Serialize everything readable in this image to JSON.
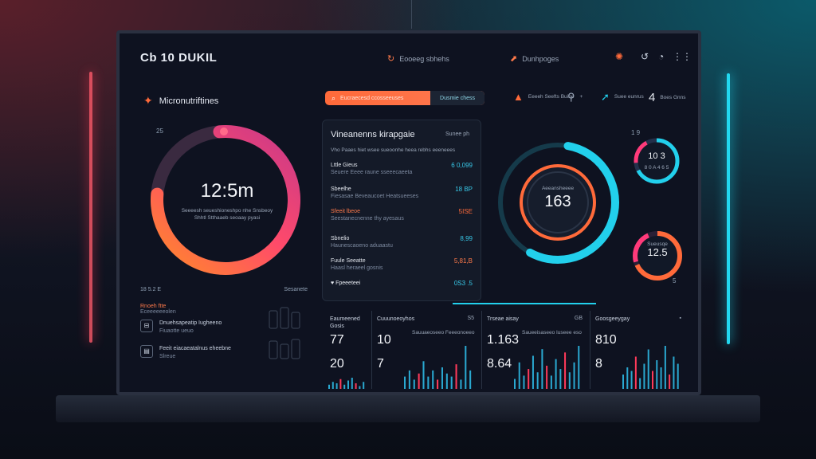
{
  "topbar": {
    "brand": "Cb 10 DUKIL",
    "item1": "Eooeeg sbhehs",
    "item2": "Dunhpoges"
  },
  "sidebar_title": "Micronutriftines",
  "search": {
    "label": "Eucraecesd ccosseeuses",
    "tab2": "Dusmie chess"
  },
  "header_stats": [
    {
      "icon": "warning-icon",
      "text": "Eeeeh Seefts Buine"
    },
    {
      "icon": "search-icon",
      "text": "+"
    },
    {
      "icon": "nav-icon",
      "text": "Suee eunrus"
    },
    {
      "icon": "four",
      "number": "4",
      "text": "Boes Gnns"
    }
  ],
  "main_ring": {
    "value": "12:5m",
    "sub": "Seeeesh seueshioneshpo nhe Snsbeoy Shhtl Stthaaeb seoaay pyasi",
    "corner": "25"
  },
  "left_list": {
    "head_left": "18 5.2 E",
    "head_right": "Sesanete",
    "top": "Rnoeh ftte",
    "top_sub": "Eceeeeeeolen",
    "items": [
      {
        "title": "Dnuehsapeatip Iugheeno",
        "sub": "Fiuaotte ueuo"
      },
      {
        "title": "Feeit eiacaeatalnus eheebne",
        "sub": "Slreue"
      }
    ]
  },
  "panel": {
    "title": "Vineanenns kirapgaie",
    "badge": "Sunee ph",
    "sub": "Vho Paaes hiet wsee sueoonhe heea rebhs eeeneees",
    "rows": [
      {
        "name": "Lttle Gieus",
        "sub": "Seuere Eeee raune sseeecaeeta",
        "value": "6 0,099",
        "style": "normal"
      },
      {
        "name": "Sbeelhe",
        "sub": "Fiesasae Beveaucoet Heatsueeses",
        "value": "18 BP",
        "style": "normal"
      },
      {
        "name": "Sfeeit lbeoe",
        "sub": "Seestanecnenne thy ayesaus",
        "value": "5ISE",
        "style": "hot"
      },
      {
        "name": "Sbnelio",
        "sub": "Haunescaoeno aduaastu",
        "value": "8,99",
        "style": "normal"
      },
      {
        "name": "Fuule Seeatte",
        "sub": "Haasl heraeel gosnis",
        "value": "5,81,B",
        "style": "hot"
      },
      {
        "name": "♥ Fpeeeteei",
        "sub": "",
        "value": "0S3 .5",
        "style": "normal"
      }
    ]
  },
  "gauge": {
    "value": "163",
    "label": "Aeeansheeee",
    "corner": "1 9"
  },
  "small_ring1": {
    "value": "10 3",
    "sub": "8 0 A 4 6 5"
  },
  "small_ring2": {
    "value": "12.5",
    "sub": "Sueusqe",
    "corner": "5"
  },
  "cards": [
    {
      "title": "Eaumeened Gosis",
      "icon": "",
      "v1": "77",
      "v2": "20",
      "sub": "",
      "bars": [
        3,
        5,
        4,
        7,
        3,
        6,
        8,
        4,
        2,
        5
      ]
    },
    {
      "title": "Cuuunoeoyhos",
      "icon": "S5",
      "v1": "10",
      "v2": "7",
      "sub": "Sauuaeoseeo Feeeonoeeo",
      "bars": [
        4,
        6,
        3,
        5,
        9,
        4,
        6,
        3,
        7,
        5,
        4,
        8,
        3,
        14,
        6
      ]
    },
    {
      "title": "Trseae aisay",
      "icon": "GB",
      "v1": "1.163",
      "v2": "8.64",
      "sub": "Saueeisaseeo Iuseee eso",
      "bars": [
        3,
        8,
        4,
        6,
        10,
        5,
        12,
        7,
        4,
        9,
        6,
        11,
        5,
        8,
        13
      ]
    },
    {
      "title": "Goosgeeygay",
      "icon": "▪",
      "v1": "810",
      "v2": "8",
      "sub": "",
      "bars": [
        4,
        6,
        5,
        9,
        3,
        7,
        11,
        5,
        8,
        6,
        12,
        4,
        9,
        7
      ]
    }
  ],
  "colors": {
    "orange": "#ff6a3a",
    "pink": "#ff3a7a",
    "cyan": "#22d0ec",
    "bg": "#0e1220"
  }
}
